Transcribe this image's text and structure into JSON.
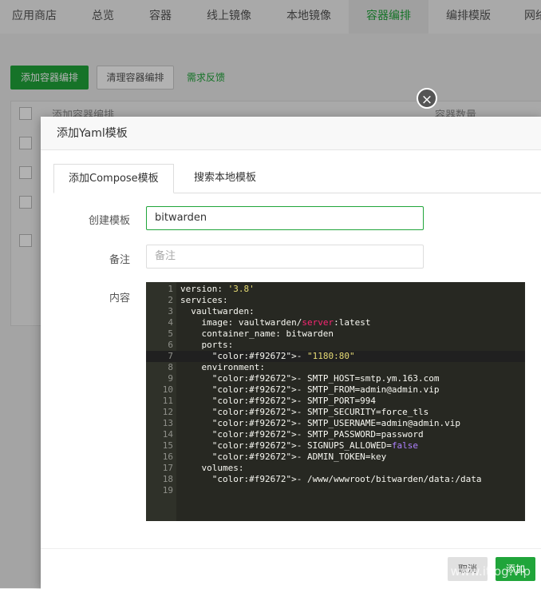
{
  "nav": {
    "tabs": [
      "应用商店",
      "总览",
      "容器",
      "线上镜像",
      "本地镜像",
      "容器编排",
      "编排模版",
      "网络"
    ],
    "active": "容器编排"
  },
  "toolbar": {
    "add_label": "添加容器编排",
    "clear_label": "清理容器编排",
    "feedback_label": "需求反馈"
  },
  "table": {
    "col_name": "添加容器编排",
    "col_count": "容器数量"
  },
  "modal": {
    "title": "添加Yaml模板",
    "tabs": [
      "添加Compose模板",
      "搜索本地模板"
    ],
    "active_tab": "添加Compose模板",
    "form": {
      "template_label": "创建模板",
      "template_value": "bitwarden",
      "remark_label": "备注",
      "remark_placeholder": "备注",
      "content_label": "内容"
    },
    "editor": {
      "active_line": 7,
      "lines": [
        "version: '3.8'",
        "services:",
        "  vaultwarden:",
        "    image: vaultwarden/server:latest",
        "    container_name: bitwarden",
        "    ports:",
        "      - \"1180:80\"",
        "    environment:",
        "      - SMTP_HOST=smtp.ym.163.com",
        "      - SMTP_FROM=admin@admin.vip",
        "      - SMTP_PORT=994",
        "      - SMTP_SECURITY=force_tls",
        "      - SMTP_USERNAME=admin@admin.vip",
        "      - SMTP_PASSWORD=password",
        "      - SIGNUPS_ALLOWED=false",
        "      - ADMIN_TOKEN=key",
        "    volumes:",
        "      - /www/wwwroot/bitwarden/data:/data",
        ""
      ]
    },
    "cancel_label": "取消",
    "confirm_label": "添加"
  },
  "watermark": "挨踢日记 | www.itlog.vip",
  "colors": {
    "accent": "#20a53a",
    "editor_bg": "#272822"
  }
}
